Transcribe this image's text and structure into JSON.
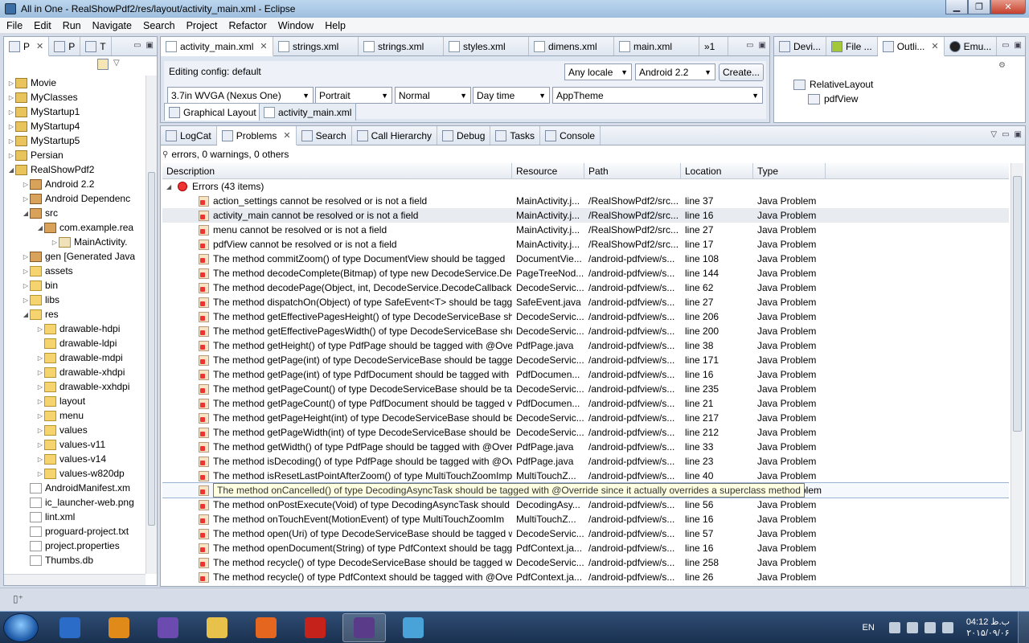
{
  "window": {
    "title": "All in One - RealShowPdf2/res/layout/activity_main.xml - Eclipse"
  },
  "menu": [
    "File",
    "Edit",
    "Run",
    "Navigate",
    "Search",
    "Project",
    "Refactor",
    "Window",
    "Help"
  ],
  "left_panel": {
    "tabs": [
      {
        "label": "P",
        "close": "✕"
      },
      {
        "label": "P"
      },
      {
        "label": "T"
      }
    ],
    "tree": [
      {
        "depth": 0,
        "arrow": "▷",
        "icon": "proj",
        "label": "Movie"
      },
      {
        "depth": 0,
        "arrow": "▷",
        "icon": "proj",
        "label": "MyClasses"
      },
      {
        "depth": 0,
        "arrow": "▷",
        "icon": "proj",
        "label": "MyStartup1"
      },
      {
        "depth": 0,
        "arrow": "▷",
        "icon": "proj",
        "label": "MyStartup4"
      },
      {
        "depth": 0,
        "arrow": "▷",
        "icon": "proj",
        "label": "MyStartup5"
      },
      {
        "depth": 0,
        "arrow": "▷",
        "icon": "proj",
        "label": "Persian"
      },
      {
        "depth": 0,
        "arrow": "◢",
        "icon": "proj",
        "label": "RealShowPdf2"
      },
      {
        "depth": 1,
        "arrow": "▷",
        "icon": "pkg",
        "label": "Android 2.2"
      },
      {
        "depth": 1,
        "arrow": "▷",
        "icon": "pkg",
        "label": "Android Dependenc"
      },
      {
        "depth": 1,
        "arrow": "◢",
        "icon": "pkg",
        "label": "src"
      },
      {
        "depth": 2,
        "arrow": "◢",
        "icon": "pkg",
        "label": "com.example.rea"
      },
      {
        "depth": 3,
        "arrow": "▷",
        "icon": "java",
        "label": "MainActivity."
      },
      {
        "depth": 1,
        "arrow": "▷",
        "icon": "pkg",
        "label": "gen [Generated Java"
      },
      {
        "depth": 1,
        "arrow": "▷",
        "icon": "folder",
        "label": "assets"
      },
      {
        "depth": 1,
        "arrow": "▷",
        "icon": "folder",
        "label": "bin"
      },
      {
        "depth": 1,
        "arrow": "▷",
        "icon": "folder",
        "label": "libs"
      },
      {
        "depth": 1,
        "arrow": "◢",
        "icon": "folder",
        "label": "res"
      },
      {
        "depth": 2,
        "arrow": "▷",
        "icon": "folder",
        "label": "drawable-hdpi"
      },
      {
        "depth": 2,
        "arrow": "",
        "icon": "folder",
        "label": "drawable-ldpi"
      },
      {
        "depth": 2,
        "arrow": "▷",
        "icon": "folder",
        "label": "drawable-mdpi"
      },
      {
        "depth": 2,
        "arrow": "▷",
        "icon": "folder",
        "label": "drawable-xhdpi"
      },
      {
        "depth": 2,
        "arrow": "▷",
        "icon": "folder",
        "label": "drawable-xxhdpi"
      },
      {
        "depth": 2,
        "arrow": "▷",
        "icon": "folder",
        "label": "layout"
      },
      {
        "depth": 2,
        "arrow": "▷",
        "icon": "folder",
        "label": "menu"
      },
      {
        "depth": 2,
        "arrow": "▷",
        "icon": "folder",
        "label": "values"
      },
      {
        "depth": 2,
        "arrow": "▷",
        "icon": "folder",
        "label": "values-v11"
      },
      {
        "depth": 2,
        "arrow": "▷",
        "icon": "folder",
        "label": "values-v14"
      },
      {
        "depth": 2,
        "arrow": "▷",
        "icon": "folder",
        "label": "values-w820dp"
      },
      {
        "depth": 1,
        "arrow": "",
        "icon": "file",
        "label": "AndroidManifest.xm"
      },
      {
        "depth": 1,
        "arrow": "",
        "icon": "file",
        "label": "ic_launcher-web.png"
      },
      {
        "depth": 1,
        "arrow": "",
        "icon": "file",
        "label": "lint.xml"
      },
      {
        "depth": 1,
        "arrow": "",
        "icon": "file",
        "label": "proguard-project.txt"
      },
      {
        "depth": 1,
        "arrow": "",
        "icon": "file",
        "label": "project.properties"
      },
      {
        "depth": 1,
        "arrow": "",
        "icon": "file",
        "label": "Thumbs.db"
      }
    ]
  },
  "editor": {
    "tabs": [
      {
        "label": "activity_main.xml",
        "close": "✕",
        "active": true
      },
      {
        "label": "strings.xml"
      },
      {
        "label": "strings.xml"
      },
      {
        "label": "styles.xml"
      },
      {
        "label": "dimens.xml"
      },
      {
        "label": "main.xml"
      },
      {
        "label": "»1"
      }
    ],
    "editing_config": "Editing config:  default",
    "locale": "Any locale",
    "api": "Android 2.2",
    "create_button": "Create...",
    "device": "3.7in WVGA (Nexus One)",
    "orientation": "Portrait",
    "mode": "Normal",
    "time": "Day time",
    "theme": "AppTheme",
    "subtabs": [
      {
        "label": "Graphical Layout"
      },
      {
        "label": "activity_main.xml"
      }
    ]
  },
  "outline": {
    "tabs": [
      {
        "label": "Devi..."
      },
      {
        "label": "File ..."
      },
      {
        "label": "Outli...",
        "close": "✕"
      },
      {
        "label": "Emu..."
      }
    ],
    "tree": [
      {
        "label": "RelativeLayout"
      },
      {
        "label": "pdfView"
      }
    ]
  },
  "problems": {
    "tabs": [
      {
        "label": "LogCat"
      },
      {
        "label": "Problems",
        "close": "✕"
      },
      {
        "label": "Search"
      },
      {
        "label": "Call Hierarchy"
      },
      {
        "label": "Debug"
      },
      {
        "label": "Tasks"
      },
      {
        "label": "Console"
      }
    ],
    "summary": "errors, 0 warnings, 0 others",
    "columns": [
      "Description",
      "Resource",
      "Path",
      "Location",
      "Type"
    ],
    "group_label": "Errors (43 items)",
    "rows": [
      {
        "d": "action_settings cannot be resolved or is not a field",
        "r": "MainActivity.j...",
        "p": "/RealShowPdf2/src...",
        "l": "line 37",
        "t": "Java Problem"
      },
      {
        "d": "activity_main cannot be resolved or is not a field",
        "r": "MainActivity.j...",
        "p": "/RealShowPdf2/src...",
        "l": "line 16",
        "t": "Java Problem"
      },
      {
        "d": "menu cannot be resolved or is not a field",
        "r": "MainActivity.j...",
        "p": "/RealShowPdf2/src...",
        "l": "line 27",
        "t": "Java Problem"
      },
      {
        "d": "pdfView cannot be resolved or is not a field",
        "r": "MainActivity.j...",
        "p": "/RealShowPdf2/src...",
        "l": "line 17",
        "t": "Java Problem"
      },
      {
        "d": "The method commitZoom() of type DocumentView should be tagged",
        "r": "DocumentVie...",
        "p": "/android-pdfview/s...",
        "l": "line 108",
        "t": "Java Problem"
      },
      {
        "d": "The method decodeComplete(Bitmap) of type new DecodeService.Dec",
        "r": "PageTreeNod...",
        "p": "/android-pdfview/s...",
        "l": "line 144",
        "t": "Java Problem"
      },
      {
        "d": "The method decodePage(Object, int, DecodeService.DecodeCallback, f",
        "r": "DecodeServic...",
        "p": "/android-pdfview/s...",
        "l": "line 62",
        "t": "Java Problem"
      },
      {
        "d": "The method dispatchOn(Object) of type SafeEvent<T> should be tagg",
        "r": "SafeEvent.java",
        "p": "/android-pdfview/s...",
        "l": "line 27",
        "t": "Java Problem"
      },
      {
        "d": "The method getEffectivePagesHeight() of type DecodeServiceBase shou",
        "r": "DecodeServic...",
        "p": "/android-pdfview/s...",
        "l": "line 206",
        "t": "Java Problem"
      },
      {
        "d": "The method getEffectivePagesWidth() of type DecodeServiceBase shou",
        "r": "DecodeServic...",
        "p": "/android-pdfview/s...",
        "l": "line 200",
        "t": "Java Problem"
      },
      {
        "d": "The method getHeight() of type PdfPage should be tagged with @Ove",
        "r": "PdfPage.java",
        "p": "/android-pdfview/s...",
        "l": "line 38",
        "t": "Java Problem"
      },
      {
        "d": "The method getPage(int) of type DecodeServiceBase should be tagged",
        "r": "DecodeServic...",
        "p": "/android-pdfview/s...",
        "l": "line 171",
        "t": "Java Problem"
      },
      {
        "d": "The method getPage(int) of type PdfDocument should be tagged with",
        "r": "PdfDocumen...",
        "p": "/android-pdfview/s...",
        "l": "line 16",
        "t": "Java Problem"
      },
      {
        "d": "The method getPageCount() of type DecodeServiceBase should be tag",
        "r": "DecodeServic...",
        "p": "/android-pdfview/s...",
        "l": "line 235",
        "t": "Java Problem"
      },
      {
        "d": "The method getPageCount() of type PdfDocument should be tagged v",
        "r": "PdfDocumen...",
        "p": "/android-pdfview/s...",
        "l": "line 21",
        "t": "Java Problem"
      },
      {
        "d": "The method getPageHeight(int) of type DecodeServiceBase should be t",
        "r": "DecodeServic...",
        "p": "/android-pdfview/s...",
        "l": "line 217",
        "t": "Java Problem"
      },
      {
        "d": "The method getPageWidth(int) of type DecodeServiceBase should be t",
        "r": "DecodeServic...",
        "p": "/android-pdfview/s...",
        "l": "line 212",
        "t": "Java Problem"
      },
      {
        "d": "The method getWidth() of type PdfPage should be tagged with @Over",
        "r": "PdfPage.java",
        "p": "/android-pdfview/s...",
        "l": "line 33",
        "t": "Java Problem"
      },
      {
        "d": "The method isDecoding() of type PdfPage should be tagged with @Ov",
        "r": "PdfPage.java",
        "p": "/android-pdfview/s...",
        "l": "line 23",
        "t": "Java Problem"
      },
      {
        "d": "The method isResetLastPointAfterZoom() of type MultiTouchZoomImp",
        "r": "MultiTouchZ...",
        "p": "/android-pdfview/s...",
        "l": "line 40",
        "t": "Java Problem"
      },
      {
        "d": "The method onCancelled() of type DecodingAsyncTask should be tagged with @Override since it actually overrides a superclass method",
        "r": "",
        "p": "",
        "l": "",
        "t": "blem"
      },
      {
        "d": "The method onPostExecute(Void) of type DecodingAsyncTask should b",
        "r": "DecodingAsy...",
        "p": "/android-pdfview/s...",
        "l": "line 56",
        "t": "Java Problem"
      },
      {
        "d": "The method onTouchEvent(MotionEvent) of type MultiTouchZoomIm",
        "r": "MultiTouchZ...",
        "p": "/android-pdfview/s...",
        "l": "line 16",
        "t": "Java Problem"
      },
      {
        "d": "The method open(Uri) of type DecodeServiceBase should be tagged wi",
        "r": "DecodeServic...",
        "p": "/android-pdfview/s...",
        "l": "line 57",
        "t": "Java Problem"
      },
      {
        "d": "The method openDocument(String) of type PdfContext should be tagg",
        "r": "PdfContext.ja...",
        "p": "/android-pdfview/s...",
        "l": "line 16",
        "t": "Java Problem"
      },
      {
        "d": "The method recycle() of type DecodeServiceBase should be tagged wit",
        "r": "DecodeServic...",
        "p": "/android-pdfview/s...",
        "l": "line 258",
        "t": "Java Problem"
      },
      {
        "d": "The method recycle() of type PdfContext should be tagged with @Ove",
        "r": "PdfContext.ja...",
        "p": "/android-pdfview/s...",
        "l": "line 26",
        "t": "Java Problem"
      }
    ]
  },
  "taskbar": {
    "lang": "EN",
    "time": "04:12 ب.ظ",
    "date": "۲۰۱۵/۰۹/۰۶",
    "apps": [
      "windows-explorer-icon",
      "internet-explorer-icon",
      "media-player-icon",
      "visual-studio-icon",
      "file-explorer-icon",
      "firefox-icon",
      "acrobat-icon",
      "eclipse-javaee-icon",
      "notepad-icon"
    ]
  }
}
